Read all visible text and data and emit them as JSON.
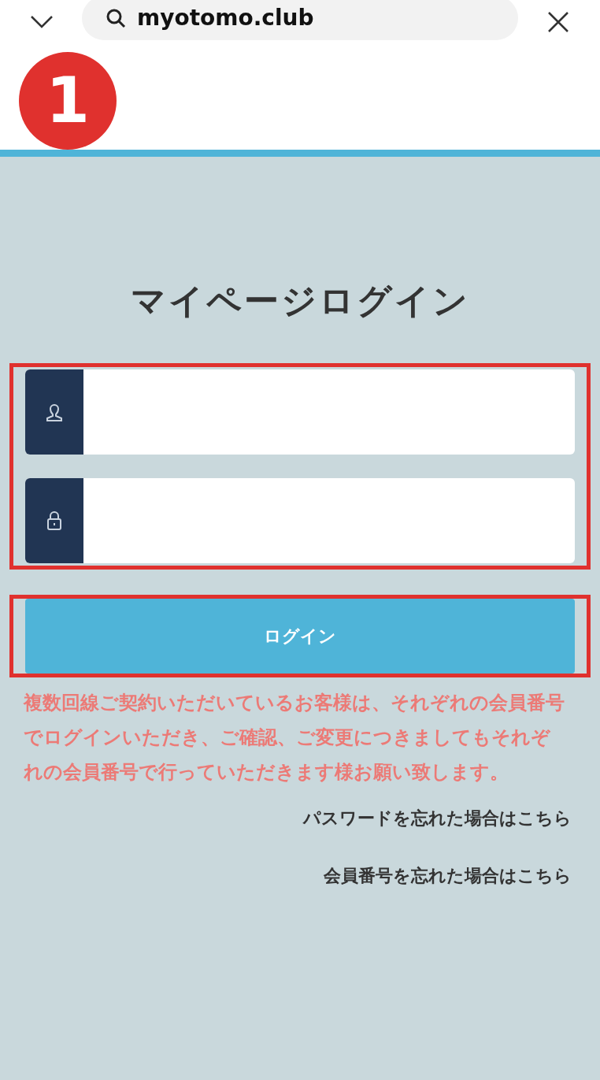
{
  "browser_bar": {
    "address": "myotomo.club"
  },
  "annotation": {
    "step": "1"
  },
  "login": {
    "title": "マイページログイン",
    "fields": [
      {
        "kind": "user"
      },
      {
        "kind": "password"
      }
    ],
    "button": "ログイン",
    "notice": "複数回線ご契約いただいているお客様は、それぞれの会員番号でログインいただき、ご確認、ご変更につきましてもそれぞれの会員番号で行っていただきます様お願い致します。",
    "links": [
      "パスワードを忘れた場合はこちら",
      "会員番号を忘れた場合はこちら"
    ]
  }
}
